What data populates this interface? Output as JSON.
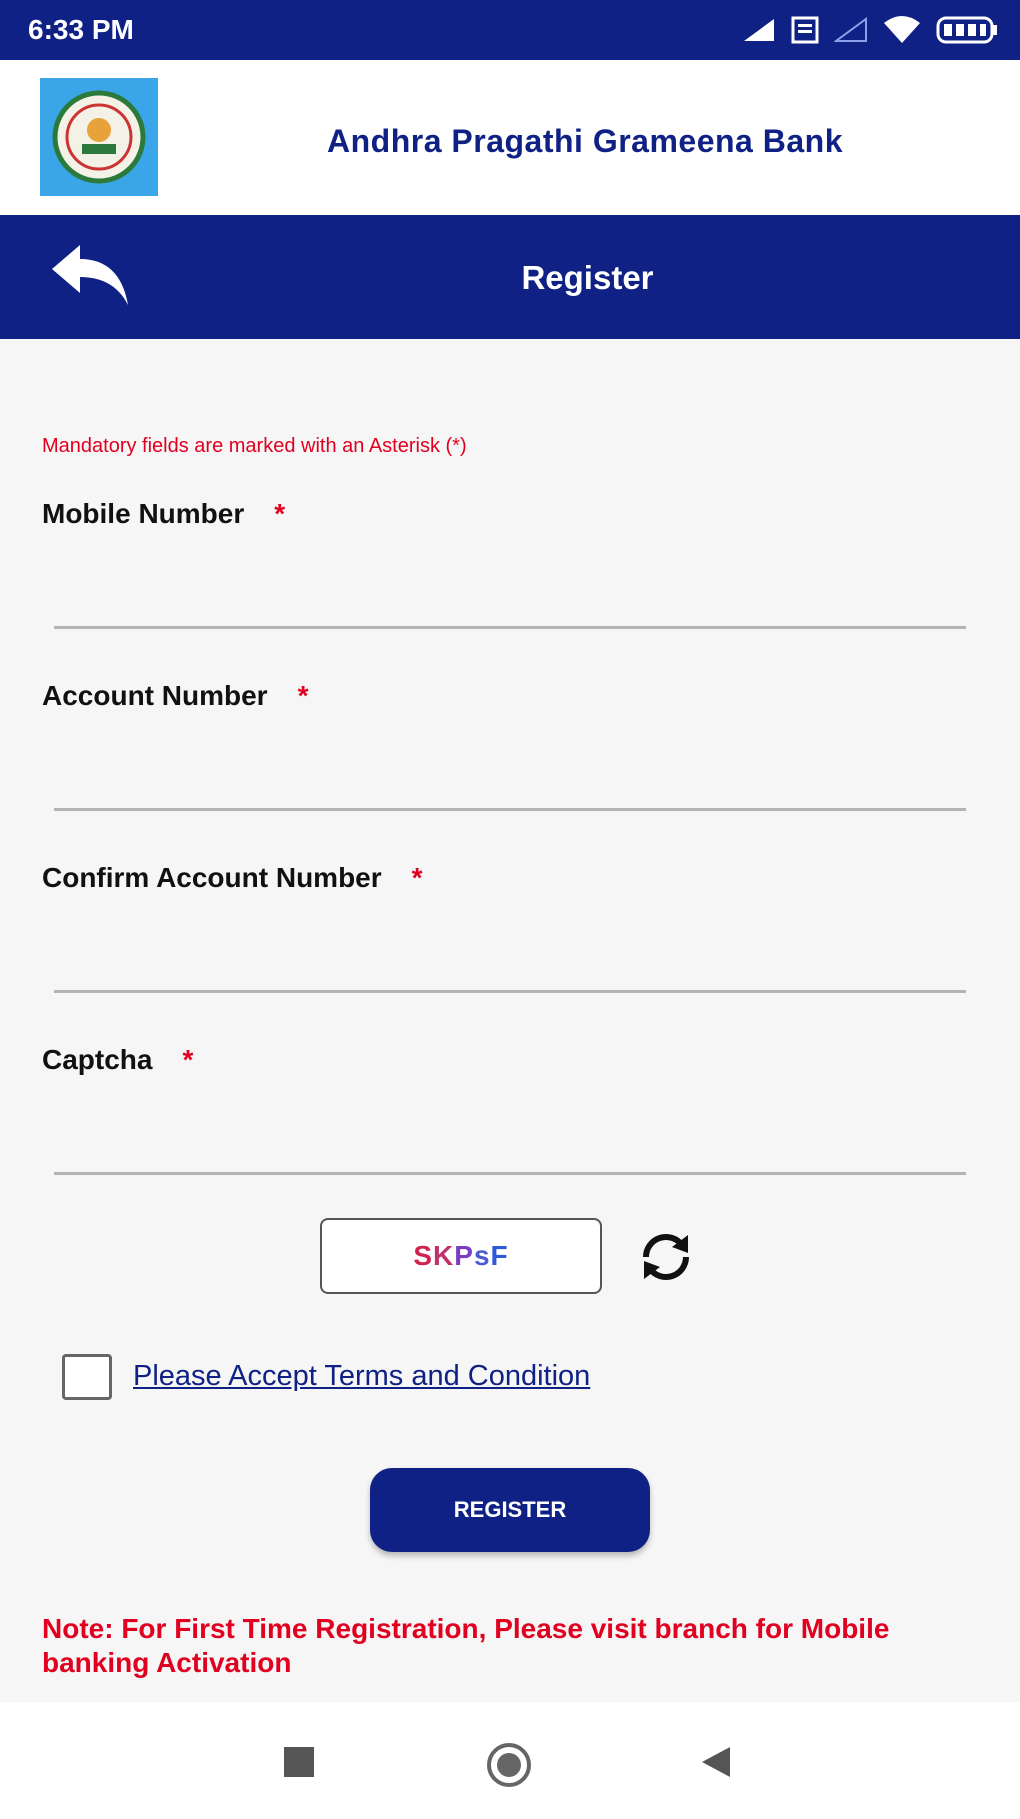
{
  "status_bar": {
    "time": "6:33 PM"
  },
  "header": {
    "bank_name": "Andhra Pragathi Grameena Bank"
  },
  "navbar": {
    "title": "Register"
  },
  "form": {
    "mandatory_note": "Mandatory fields are marked with an Asterisk (*)",
    "asterisk": "*",
    "fields": [
      {
        "label": "Mobile Number",
        "value": ""
      },
      {
        "label": "Account Number",
        "value": ""
      },
      {
        "label": "Confirm Account Number",
        "value": ""
      },
      {
        "label": "Captcha",
        "value": ""
      }
    ],
    "captcha": {
      "chars": [
        "S",
        "K",
        "P",
        "s",
        "F"
      ],
      "colors": [
        "#d4224f",
        "#c0306a",
        "#7a3cc0",
        "#4a5ad0",
        "#2d58d8"
      ]
    },
    "terms": {
      "label": "Please Accept Terms and Condition",
      "checked": false
    },
    "register_label": "REGISTER",
    "bottom_note": "Note: For First Time Registration, Please visit branch for Mobile banking Activation"
  },
  "colors": {
    "primary": "#0f2185",
    "accent_red": "#e1001f",
    "logo_bg": "#3aa6e8"
  }
}
